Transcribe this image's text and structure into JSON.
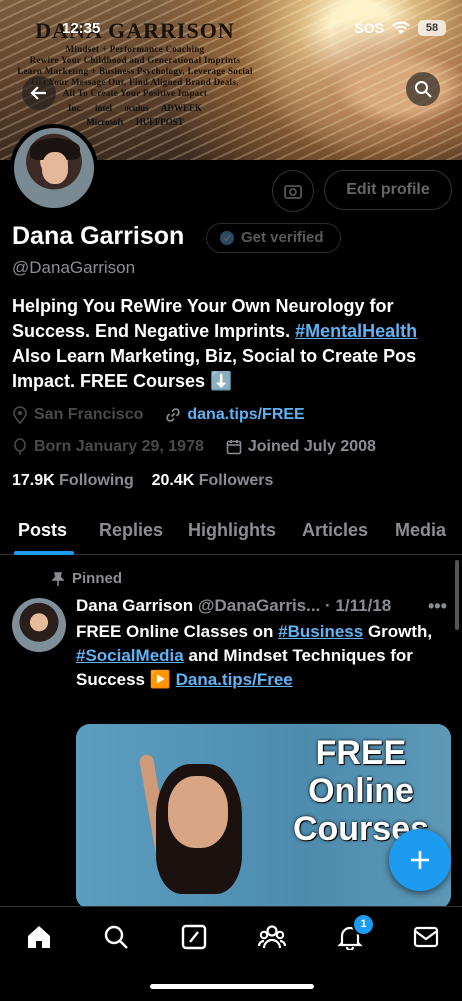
{
  "status_bar": {
    "time": "12:35",
    "sos": "SOS",
    "battery": "58"
  },
  "banner": {
    "name": "DANA GARRISON",
    "lines": [
      "Mindset + Performance Coaching",
      "Rewire Your Childhood and Generational Imprints",
      "Learn Marketing + Business Psychology, Leverage Social",
      "Get Your Message Out, Find Aligned Brand Deals,",
      "All To Create Your Positive Impact"
    ],
    "logos_row1": [
      "Inc.",
      "intel",
      "oculus",
      "ADWEEK"
    ],
    "logos_row2": [
      "Microsoft",
      "HUFFPOST"
    ]
  },
  "profile": {
    "edit_profile": "Edit profile",
    "name": "Dana Garrison",
    "get_verified": "Get verified",
    "handle": "@DanaGarrison",
    "bio_part1": "Helping You ReWire Your Own Neurology for Success. End Negative Imprints. ",
    "bio_tag": "#MentalHealth",
    "bio_part2": " Also Learn Marketing, Biz, Social to Create Pos Impact. FREE Courses ⬇️",
    "location": "San Francisco",
    "website": "dana.tips/FREE",
    "born": "Born January 29, 1978",
    "joined": "Joined July 2008",
    "following_count": "17.9K",
    "following_label": "Following",
    "followers_count": "20.4K",
    "followers_label": "Followers"
  },
  "tabs": [
    "Posts",
    "Replies",
    "Highlights",
    "Articles",
    "Media"
  ],
  "post": {
    "pinned": "Pinned",
    "author": "Dana Garrison",
    "handle": "@DanaGarris...",
    "date": "· 1/11/18",
    "t1": "FREE Online Classes on ",
    "tag1": "#Business",
    "t2": " Growth, ",
    "tag2": "#SocialMedia",
    "t3": " and Mindset Techniques for Success ▶️ ",
    "link": "Dana.tips/Free",
    "image_text": "FREE Online Courses"
  },
  "nav": {
    "notifications_badge": "1"
  },
  "icons": [
    "back-icon",
    "search-icon",
    "camera-icon",
    "verified-icon",
    "location-icon",
    "link-icon",
    "balloon-icon",
    "calendar-icon",
    "pin-icon",
    "more-icon",
    "plus-icon",
    "home-icon",
    "compose-icon",
    "communities-icon",
    "bell-icon",
    "mail-icon"
  ],
  "colors": {
    "accent": "#1d9bf0",
    "link": "#5fb3f5",
    "background": "#000000"
  }
}
